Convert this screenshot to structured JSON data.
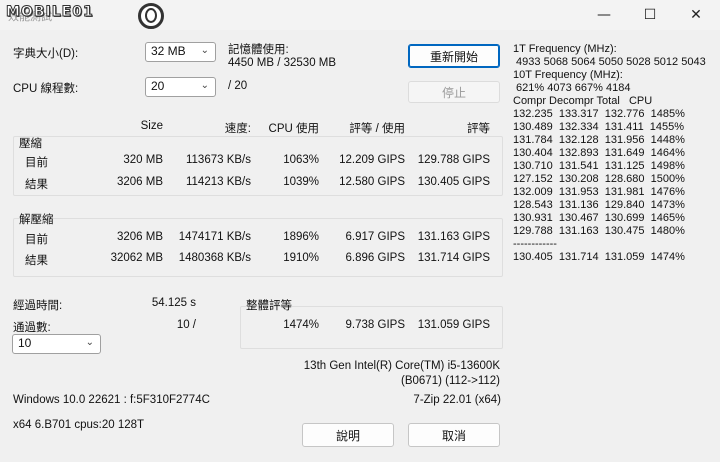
{
  "window": {
    "title_logo": "MOBILE01",
    "title_behind": "效能測試",
    "minimize_glyph": "—",
    "maximize_glyph": "☐",
    "close_glyph": "✕"
  },
  "settings": {
    "dict_label": "字典大小(D):",
    "dict_value": "32 MB",
    "threads_label": "CPU 線程數:",
    "threads_value": "20",
    "threads_total": "/ 20",
    "memory_label": "記憶體使用:",
    "memory_value": "4450 MB / 32530 MB"
  },
  "buttons": {
    "restart": "重新開始",
    "stop": "停止",
    "help": "說明",
    "cancel": "取消"
  },
  "headers": {
    "size": "Size",
    "speed": "速度:",
    "cpu_usage": "CPU 使用",
    "rating_usage": "評等 / 使用",
    "rating": "評等"
  },
  "compression": {
    "title": "壓縮",
    "rows": [
      {
        "label": "目前",
        "size": "320 MB",
        "speed": "113673 KB/s",
        "cpu": "1063%",
        "rating_usage": "12.209 GIPS",
        "rating": "129.788 GIPS"
      },
      {
        "label": "結果",
        "size": "3206 MB",
        "speed": "114213 KB/s",
        "cpu": "1039%",
        "rating_usage": "12.580 GIPS",
        "rating": "130.405 GIPS"
      }
    ]
  },
  "decompression": {
    "title": "解壓縮",
    "rows": [
      {
        "label": "目前",
        "size": "3206 MB",
        "speed": "1474171 KB/s",
        "cpu": "1896%",
        "rating_usage": "6.917 GIPS",
        "rating": "131.163 GIPS"
      },
      {
        "label": "結果",
        "size": "32062 MB",
        "speed": "1480368 KB/s",
        "cpu": "1910%",
        "rating_usage": "6.896 GIPS",
        "rating": "131.714 GIPS"
      }
    ]
  },
  "elapsed": {
    "label": "經過時間:",
    "value": "54.125 s",
    "passes_label": "通過數:",
    "passes_value": "10 /",
    "passes_select": "10"
  },
  "overall": {
    "title": "整體評等",
    "cpu": "1474%",
    "rating_usage": "9.738 GIPS",
    "rating": "131.059 GIPS"
  },
  "sysinfo": {
    "cpu_name": "13th Gen Intel(R) Core(TM) i5-13600K",
    "cpu_id": "(B0671) (112->112)",
    "os": "Windows 10.0 22621 : f:5F310F2774C",
    "zip": "7-Zip 22.01 (x64)",
    "arch": "x64 6.B701 cpus:20 128T"
  },
  "freq": {
    "line1_label": "1T Frequency (MHz):",
    "line1_values": " 4933 5068 5064 5050 5028 5012 5043",
    "line2_label": "10T Frequency (MHz):",
    "line2_values": " 621% 4073 667% 4184",
    "table_header": "Compr Decompr Total   CPU",
    "rows": [
      "132.235  133.317  132.776  1485%",
      "130.489  132.334  131.411  1455%",
      "131.784  132.128  131.956  1448%",
      "130.404  132.893  131.649  1464%",
      "130.710  131.541  131.125  1498%",
      "127.152  130.208  128.680  1500%",
      "132.009  131.953  131.981  1476%",
      "128.543  131.136  129.840  1473%",
      "130.931  130.467  130.699  1465%",
      "129.788  131.163  130.475  1480%"
    ],
    "separator": "------------",
    "total": "130.405  131.714  131.059  1474%"
  }
}
